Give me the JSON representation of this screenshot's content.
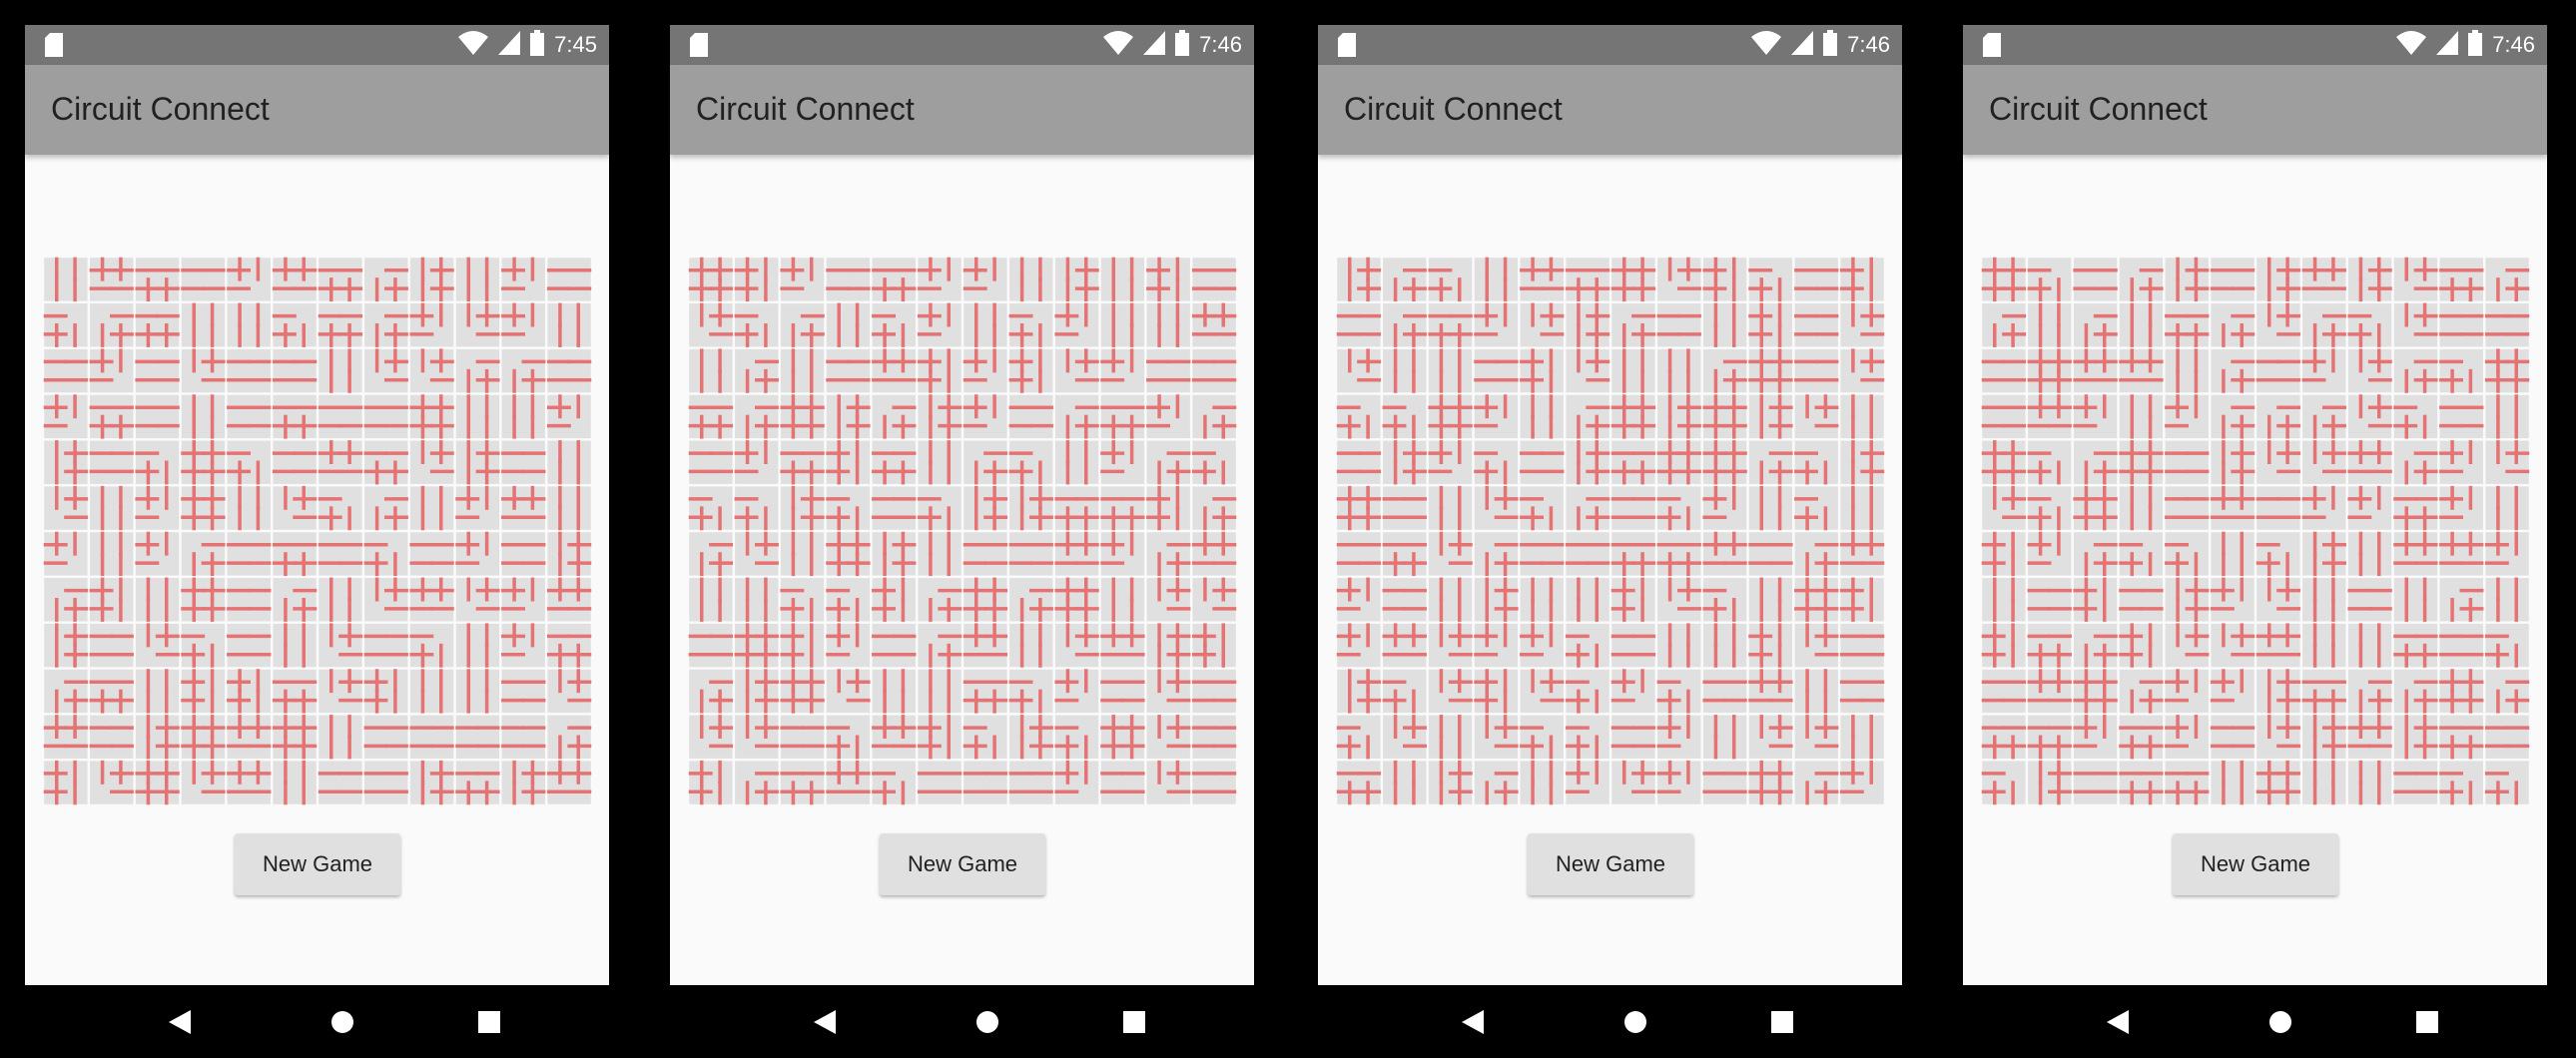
{
  "colors": {
    "statusbar": "#757575",
    "toolbar": "#9e9e9e",
    "background": "#fafafa",
    "tile": "#e0e0e0",
    "wire": "#e57373",
    "button": "#e0e0e0"
  },
  "icons": [
    "sd-card-icon",
    "wifi-icon",
    "signal-icon",
    "battery-icon",
    "back-icon",
    "home-icon",
    "recents-icon"
  ],
  "board": {
    "rows": 12,
    "cols": 12,
    "state": "scrambled"
  },
  "screens": [
    {
      "time": "7:45",
      "title": "Circuit Connect",
      "button_label": "New Game"
    },
    {
      "time": "7:46",
      "title": "Circuit Connect",
      "button_label": "New Game"
    },
    {
      "time": "7:46",
      "title": "Circuit Connect",
      "button_label": "New Game"
    },
    {
      "time": "7:46",
      "title": "Circuit Connect",
      "button_label": "New Game"
    }
  ]
}
